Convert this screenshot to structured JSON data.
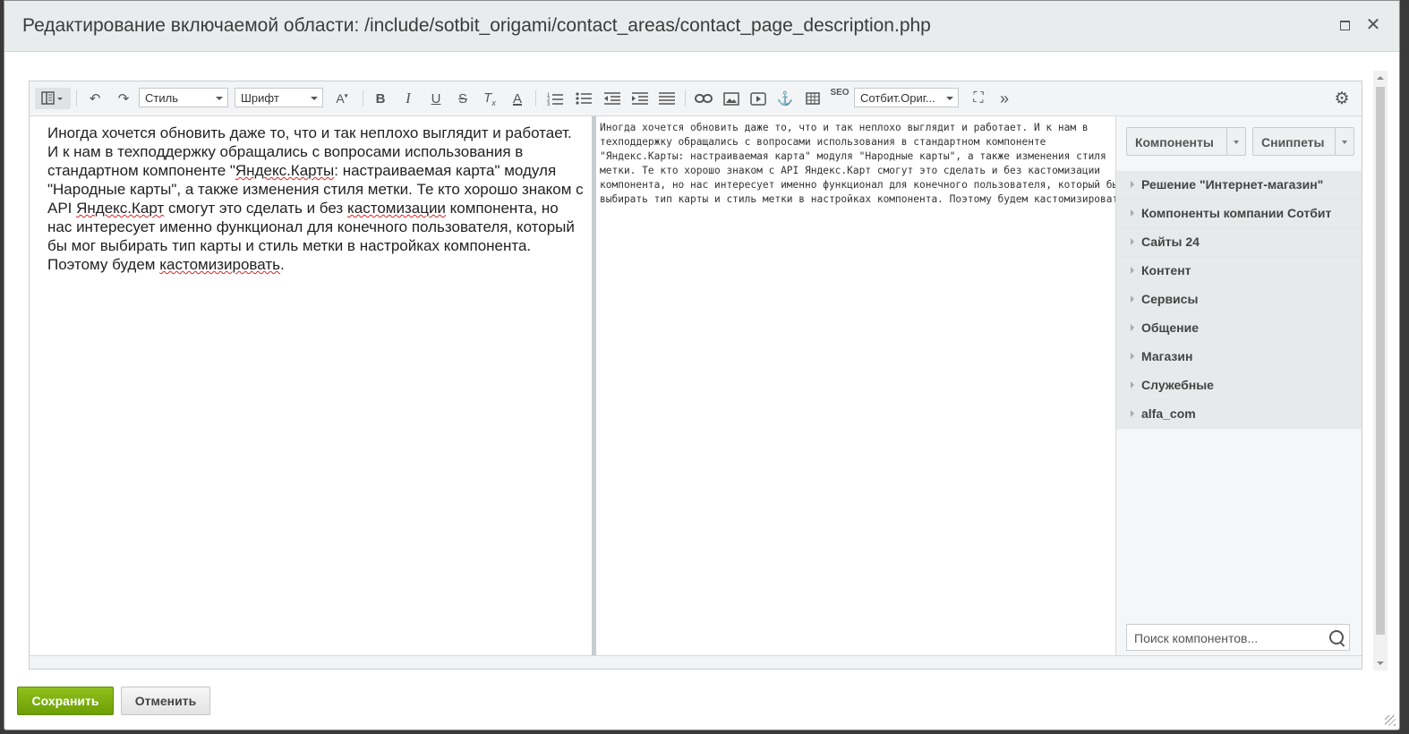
{
  "dialog": {
    "title": "Редактирование включаемой области: /include/sotbit_origami/contact_areas/contact_page_description.php"
  },
  "toolbar": {
    "style_select": "Стиль",
    "font_select": "Шрифт",
    "template_select": "Сотбит.Ориг...",
    "seo_label": "SEO"
  },
  "editor": {
    "wysiwyg_parts": [
      "Иногда хочется обновить даже то, что и так неплохо выглядит и работает. И к нам в техподдержку обращались с вопросами использования в стандартном компоненте \"",
      "Яндекс.Карты",
      ": настраиваемая карта\" модуля \"Народные карты\", а также изменения стиля метки. Те кто хорошо знаком с API ",
      "Яндекс.Карт",
      " смогут это сделать и без ",
      "кастомизации",
      " компонента, но нас интересует именно функционал для конечного пользователя, который бы мог выбирать тип карты и стиль метки в настройках компонента. Поэтому будем ",
      "кастомизировать",
      "."
    ],
    "code_lines": [
      "Иногда хочется обновить даже то, что и так неплохо выглядит и работает. И к нам в",
      "техподдержку обращались с вопросами использования в стандартном компоненте",
      "\"Яндекс.Карты: настраиваемая карта\" модуля \"Народные карты\", а также изменения стиля",
      "метки. Те кто хорошо знаком с API Яндекс.Карт смогут это сделать и без кастомизации",
      "компонента, но нас интересует именно функционал для конечного пользователя, который бы мог",
      "выбирать тип карты и стиль метки в настройках компонента. Поэтому будем кастомизировать."
    ]
  },
  "sidebar": {
    "components_button": "Компоненты",
    "snippets_button": "Сниппеты",
    "groups": [
      "Решение \"Интернет-магазин\"",
      "Компоненты компании Сотбит",
      "Сайты 24",
      "Контент",
      "Сервисы",
      "Общение",
      "Магазин",
      "Служебные",
      "alfa_com"
    ],
    "search_placeholder": "Поиск компонентов..."
  },
  "footer": {
    "save": "Сохранить",
    "cancel": "Отменить"
  },
  "colors": {
    "save_green": "#7aad0f",
    "titlebar_bg": "#e8eced"
  }
}
